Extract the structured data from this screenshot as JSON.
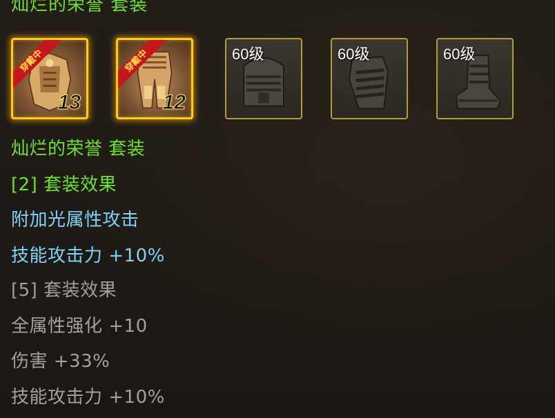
{
  "set": {
    "top_title": "灿烂的荣誉 套装",
    "name": "灿烂的荣誉 套装"
  },
  "slots": [
    {
      "state": "equipped",
      "ribbon": "穿戴中",
      "enhance": "13",
      "icon": "chest-armor-icon"
    },
    {
      "state": "equipped",
      "ribbon": "穿戴中",
      "enhance": "12",
      "icon": "leg-armor-icon"
    },
    {
      "state": "locked",
      "level": "60级",
      "icon": "helmet-icon"
    },
    {
      "state": "locked",
      "level": "60级",
      "icon": "shoulder-armor-icon"
    },
    {
      "state": "locked",
      "level": "60级",
      "icon": "boots-icon"
    }
  ],
  "bonus2": {
    "header": "[2] 套装效果",
    "line1": "附加光属性攻击",
    "line2": "技能攻击力 +10%"
  },
  "bonus5": {
    "header": "[5] 套装效果",
    "line1": "全属性强化 +10",
    "line2": "伤害 +33%",
    "line3": "技能攻击力 +10%"
  },
  "colors": {
    "set_name": "#6fe03b",
    "active_bonus": "#7fd3f7",
    "inactive_bonus": "#a6a09a",
    "frame_active": "#ffcc1a",
    "frame_inactive": "#b69a3c"
  }
}
